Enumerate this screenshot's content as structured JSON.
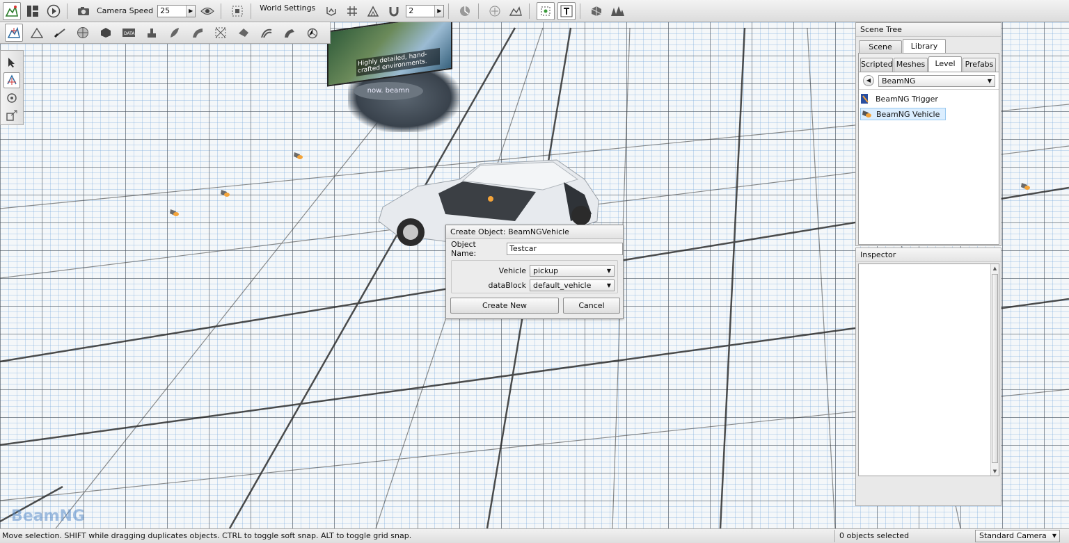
{
  "toolbar": {
    "camera_speed_label": "Camera Speed",
    "camera_speed_value": "25",
    "world_settings_label": "World Settings",
    "snap_value": "2"
  },
  "viewport": {
    "billboard_caption": "Highly detailed, hand-crafted environments.",
    "stand_text": "now. beamn",
    "watermark": "BeamNG"
  },
  "dialog": {
    "title": "Create Object: BeamNGVehicle",
    "object_name_label": "Object Name:",
    "object_name_value": "Testcar",
    "vehicle_label": "Vehicle",
    "vehicle_value": "pickup",
    "datablock_label": "dataBlock",
    "datablock_value": "default_vehicle",
    "create_label": "Create New",
    "cancel_label": "Cancel"
  },
  "scene_tree": {
    "title": "Scene Tree",
    "tabs": [
      "Scene",
      "Library"
    ],
    "selected_tab": "Library",
    "subtabs": [
      "Scripted",
      "Meshes",
      "Level",
      "Prefabs"
    ],
    "selected_subtab": "Level",
    "category_value": "BeamNG",
    "items": [
      "BeamNG Trigger",
      "BeamNG Vehicle"
    ],
    "selected_item": "BeamNG Vehicle"
  },
  "inspector": {
    "title": "Inspector"
  },
  "status": {
    "message": "Move selection.  SHIFT while dragging duplicates objects.  CTRL to toggle soft snap.  ALT to toggle grid snap.",
    "selection_count": "0 objects selected",
    "camera_mode": "Standard Camera"
  },
  "colors": {
    "selection_highlight": "#dbeeff",
    "panel_bg": "#e9e9e9",
    "grid_minor": "#78aadc"
  },
  "icons": {
    "toolbar1": [
      "editor-mode-icon",
      "layout-icon",
      "play-icon",
      "camera-icon",
      "visibility-eye-icon",
      "fit-view-icon",
      "snap-to-terrain-icon",
      "grid-snap-icon",
      "bounds-snap-icon",
      "magnet-icon",
      "rotate-snap-icon",
      "terrain-icon",
      "select-icon",
      "gizmo-icon",
      "text-icon",
      "mesh-icon",
      "forest-icon"
    ],
    "toolbar2": [
      "object-editor-icon",
      "terrain-editor-icon",
      "terrain-painter-icon",
      "material-icon",
      "sketch-icon",
      "datablock-icon",
      "decal-icon",
      "forest-editor-icon",
      "mesh-road-icon",
      "navmesh-icon",
      "river-icon",
      "road-icon",
      "decal-road-icon",
      "particle-icon"
    ]
  }
}
